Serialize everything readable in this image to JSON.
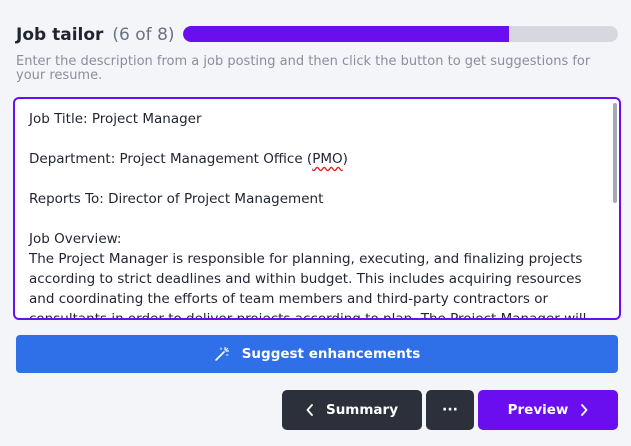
{
  "header": {
    "title": "Job tailor",
    "step_count": "(6 of 8)",
    "progress_fraction": 0.75
  },
  "hint": "Enter the description from a job posting and then click the button to get suggestions for your resume.",
  "job_description": {
    "line_title": "Job Title: Project Manager",
    "line_department_prefix": "Department: Project Management Office (",
    "line_department_acronym": "PMO",
    "line_department_suffix": ")",
    "line_reports": "Reports To: Director of Project Management",
    "line_overview_heading": "Job Overview:",
    "line_overview_body": "The Project Manager is responsible for planning, executing, and finalizing projects according to strict deadlines and within budget. This includes acquiring resources and coordinating the efforts of team members and third-party contractors or consultants in order to deliver projects according to plan. The Project Manager will also define the project's objectives and"
  },
  "buttons": {
    "suggest_label": "Suggest enhancements",
    "summary_label": "Summary",
    "more_label": "···",
    "preview_label": "Preview"
  },
  "icons": {
    "suggest": "magic-wand-icon",
    "summary": "chevron-left-icon",
    "preview": "chevron-right-icon"
  },
  "colors": {
    "accent": "#6a0ef0",
    "suggest_button": "#2f6fe8",
    "dark_button": "#2b303a"
  }
}
